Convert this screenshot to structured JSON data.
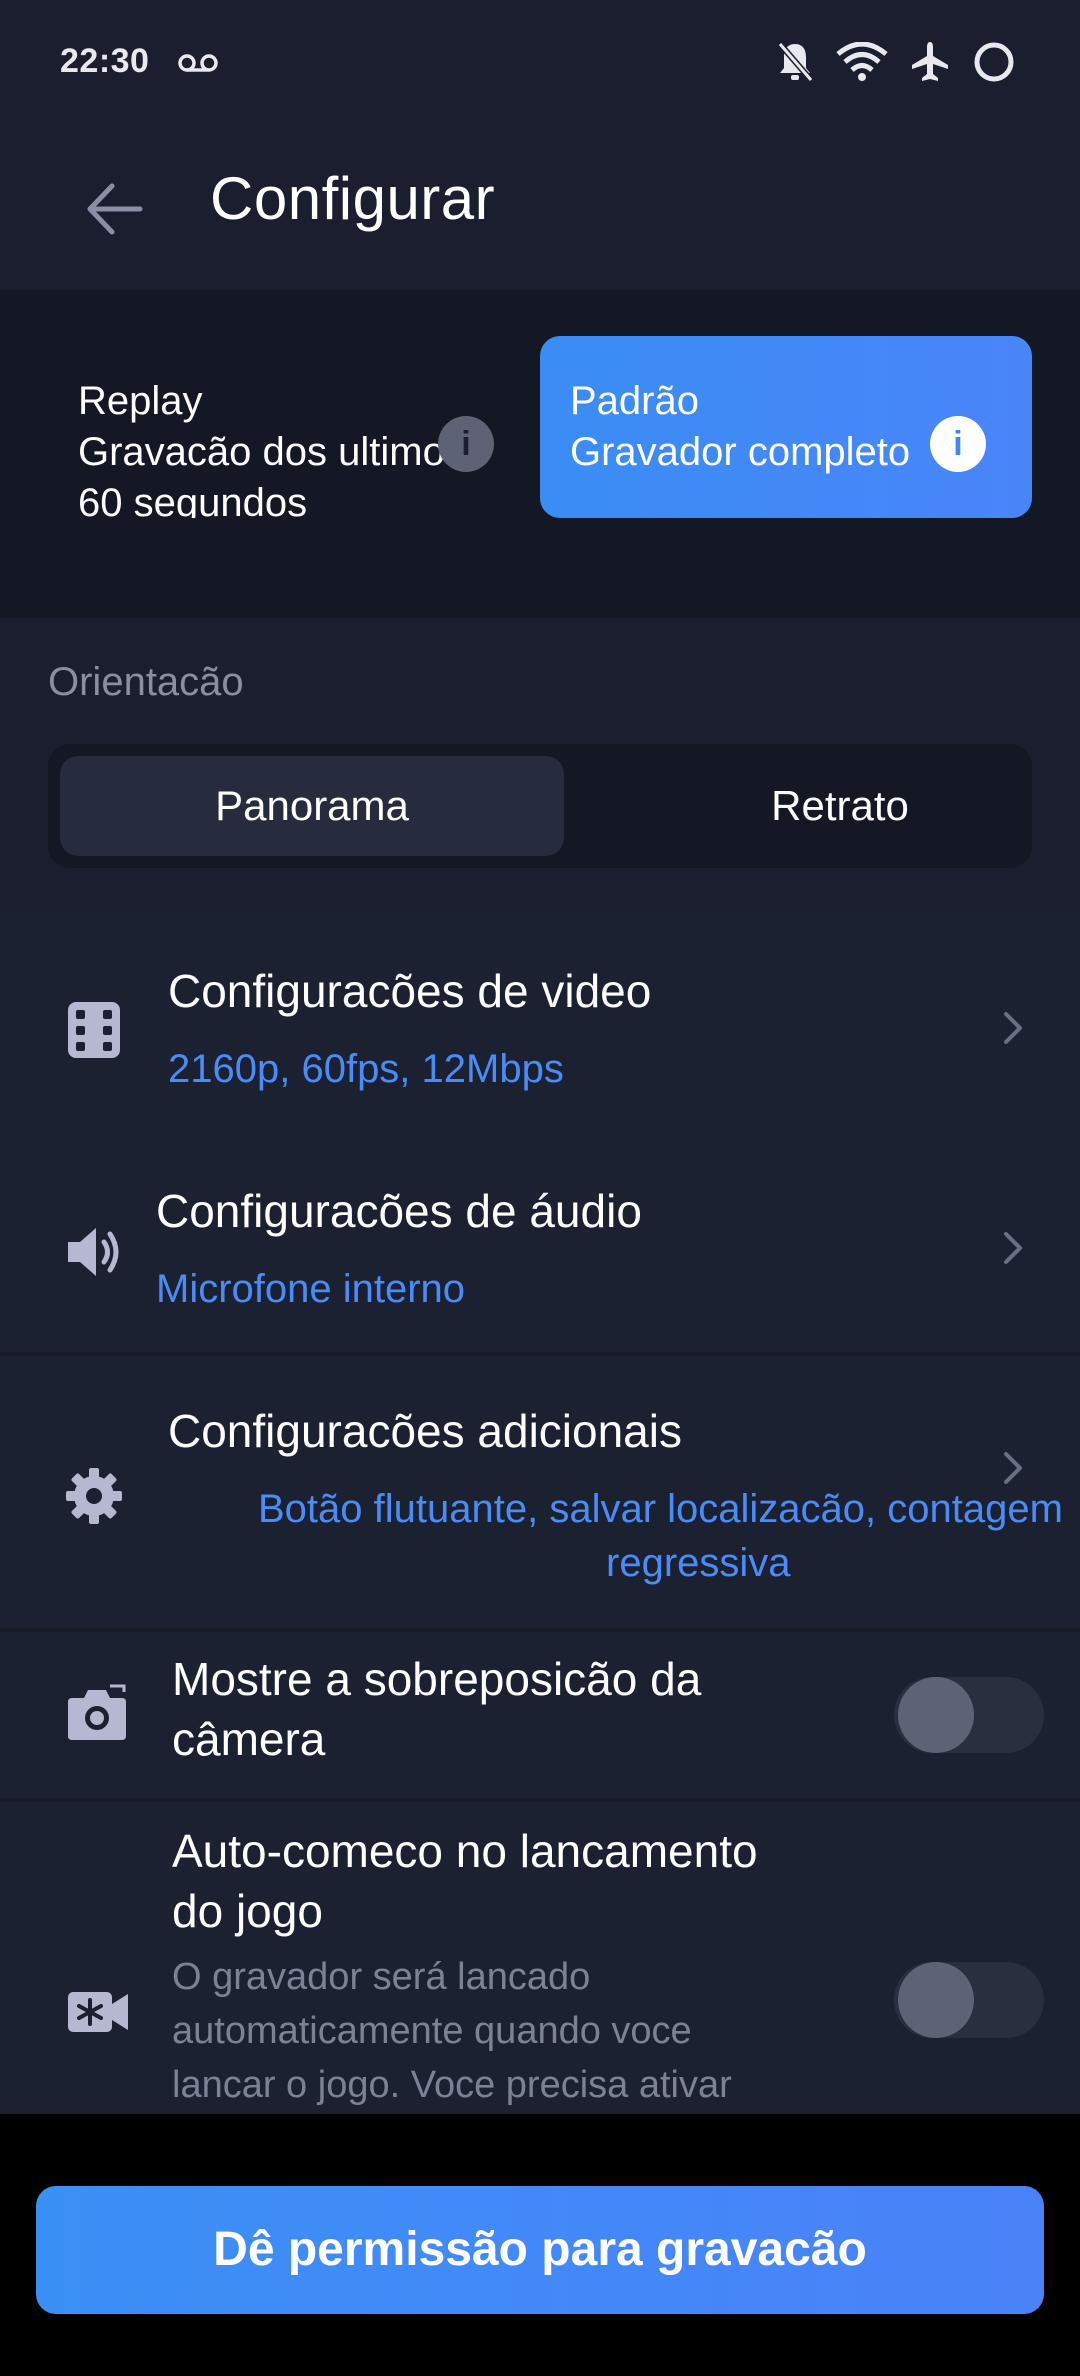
{
  "status_bar": {
    "time": "22:30",
    "icons": [
      "voicemail-icon",
      "notifications-off-icon",
      "wifi-icon",
      "airplane-icon",
      "battery-ring-icon"
    ]
  },
  "header": {
    "title": "Configurar",
    "back_icon": "arrow-left-icon"
  },
  "modes": {
    "replay": {
      "line1": "Replay",
      "line2": "Gravacão dos ultimos",
      "line3": "60 segundos",
      "info_icon": "info-icon",
      "selected": false
    },
    "padrao": {
      "line1": "Padrão",
      "line2": "Gravador completo",
      "info_icon": "info-icon",
      "selected": true
    }
  },
  "orientation": {
    "label": "Orientacão",
    "options": [
      {
        "label": "Panorama",
        "selected": true
      },
      {
        "label": "Retrato",
        "selected": false
      }
    ]
  },
  "settings": {
    "video": {
      "title": "Configuracões de video",
      "value": "2160p, 60fps, 12Mbps",
      "icon": "film-icon"
    },
    "audio": {
      "title": "Configuracões de áudio",
      "value": "Microfone interno",
      "icon": "speaker-icon"
    },
    "additional": {
      "title": "Configuracões adicionais",
      "value_line1": "Botão flutuante, salvar localizacão, contagem",
      "value_line2": "regressiva",
      "icon": "gear-icon"
    },
    "camera_overlay": {
      "title_line1": "Mostre a sobreposicão da",
      "title_line2": "câmera",
      "icon": "camera-icon",
      "enabled": false
    },
    "autostart": {
      "title_line1": "Auto-comeco no lancamento",
      "title_line2": "do jogo",
      "desc_line1": "O gravador será lancado",
      "desc_line2": "automaticamente quando voce",
      "desc_line3": "lancar o jogo. Voce precisa ativar",
      "icon": "video-camera-icon",
      "enabled": false
    }
  },
  "cta": {
    "label": "Dê permissão para gravacão"
  },
  "colors": {
    "background": "#1a1e2e",
    "accent": "#4a8cf7",
    "panel": "#141824"
  }
}
